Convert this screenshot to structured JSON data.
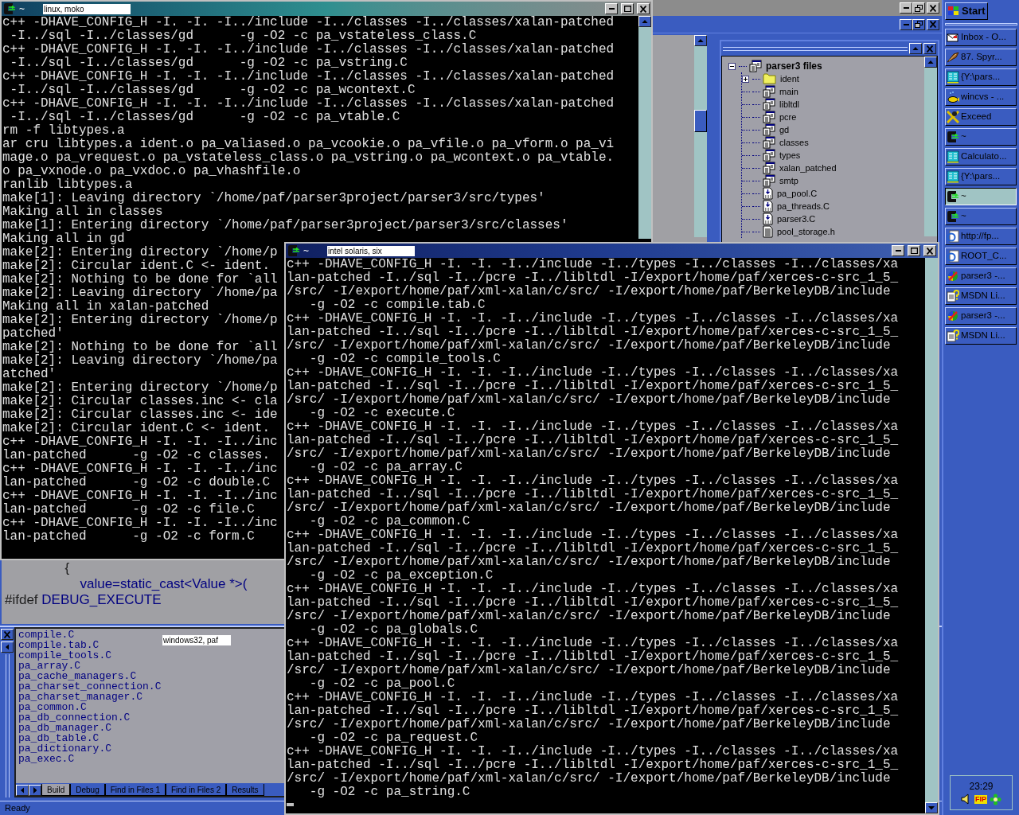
{
  "ide": {
    "code_lines": [
      [
        {
          "text": "                {",
          "kind": "plain"
        }
      ],
      [
        {
          "text": "                    value=static_cast<Value *>(",
          "kind": "identifier"
        }
      ],
      [
        {
          "text": "#ifdef ",
          "kind": "plain"
        },
        {
          "text": "DEBUG_EXECUTE",
          "kind": "identifier"
        }
      ]
    ],
    "tree": {
      "label": "parser3 files",
      "kind": "workspace",
      "expanded": true,
      "children": [
        {
          "label": "ident",
          "kind": "folder",
          "expanded": false
        },
        {
          "label": "main",
          "kind": "project"
        },
        {
          "label": "libltdl",
          "kind": "project"
        },
        {
          "label": "pcre",
          "kind": "project"
        },
        {
          "label": "gd",
          "kind": "project"
        },
        {
          "label": "classes",
          "kind": "project"
        },
        {
          "label": "types",
          "kind": "project"
        },
        {
          "label": "xalan_patched",
          "kind": "project"
        },
        {
          "label": "smtp",
          "kind": "project"
        },
        {
          "label": "pa_pool.C",
          "kind": "source"
        },
        {
          "label": "pa_threads.C",
          "kind": "source"
        },
        {
          "label": "parser3.C",
          "kind": "source"
        },
        {
          "label": "pool_storage.h",
          "kind": "header"
        }
      ]
    },
    "output_files": [
      "compile.C",
      "compile.tab.C",
      "compile_tools.C",
      "pa_array.C",
      "pa_cache_managers.C",
      "pa_charset_connection.C",
      "pa_charset_manager.C",
      "pa_common.C",
      "pa_db_connection.C",
      "pa_db_manager.C",
      "pa_db_table.C",
      "pa_dictionary.C",
      "pa_exec.C"
    ],
    "output_tabs": [
      {
        "label": "Build",
        "selected": true
      },
      {
        "label": "Debug",
        "selected": false
      },
      {
        "label": "Find in Files 1",
        "selected": false
      },
      {
        "label": "Find in Files 2",
        "selected": false
      },
      {
        "label": "Results",
        "selected": false
      }
    ],
    "host_label": "windows32, paf",
    "status": "Ready"
  },
  "terminals": [
    {
      "title": "~",
      "host": "linux, moko",
      "lines": [
        "c++ -DHAVE_CONFIG_H -I. -I. -I../include -I../classes -I../classes/xalan-patched",
        " -I../sql -I../classes/gd      -g -O2 -c pa_vstateless_class.C",
        "c++ -DHAVE_CONFIG_H -I. -I. -I../include -I../classes -I../classes/xalan-patched",
        " -I../sql -I../classes/gd      -g -O2 -c pa_vstring.C",
        "c++ -DHAVE_CONFIG_H -I. -I. -I../include -I../classes -I../classes/xalan-patched",
        " -I../sql -I../classes/gd      -g -O2 -c pa_wcontext.C",
        "c++ -DHAVE_CONFIG_H -I. -I. -I../include -I../classes -I../classes/xalan-patched",
        " -I../sql -I../classes/gd      -g -O2 -c pa_vtable.C",
        "rm -f libtypes.a",
        "ar cru libtypes.a ident.o pa_valiased.o pa_vcookie.o pa_vfile.o pa_vform.o pa_vi",
        "mage.o pa_vrequest.o pa_vstateless_class.o pa_vstring.o pa_wcontext.o pa_vtable.",
        "o pa_vxnode.o pa_vxdoc.o pa_vhashfile.o",
        "ranlib libtypes.a",
        "make[1]: Leaving directory `/home/paf/parser3project/parser3/src/types'",
        "Making all in classes",
        "make[1]: Entering directory `/home/paf/parser3project/parser3/src/classes'",
        "Making all in gd",
        "make[2]: Entering directory `/home/p",
        "make[2]: Circular ident.C <- ident.",
        "make[2]: Nothing to be done for `all",
        "make[2]: Leaving directory `/home/pa",
        "Making all in xalan-patched",
        "make[2]: Entering directory `/home/p",
        "patched'",
        "make[2]: Nothing to be done for `all",
        "make[2]: Leaving directory `/home/pa",
        "atched'",
        "make[2]: Entering directory `/home/p",
        "make[2]: Circular classes.inc <- cla",
        "make[2]: Circular classes.inc <- ide",
        "make[2]: Circular ident.C <- ident.",
        "c++ -DHAVE_CONFIG_H -I. -I. -I../inc",
        "lan-patched      -g -O2 -c classes.",
        "c++ -DHAVE_CONFIG_H -I. -I. -I../inc",
        "lan-patched      -g -O2 -c double.C",
        "c++ -DHAVE_CONFIG_H -I. -I. -I../inc",
        "lan-patched      -g -O2 -c file.C",
        "c++ -DHAVE_CONFIG_H -I. -I. -I../inc",
        "lan-patched      -g -O2 -c form.C"
      ]
    },
    {
      "title": "~",
      "host": "intel solaris, six",
      "lines": [
        "c++ -DHAVE_CONFIG_H -I. -I. -I../include -I../types -I../classes -I../classes/xa",
        "lan-patched -I../sql -I../pcre -I../libltdl -I/export/home/paf/xerces-c-src_1_5_",
        "/src/ -I/export/home/paf/xml-xalan/c/src/ -I/export/home/paf/BerkeleyDB/include",
        "   -g -O2 -c compile.tab.C",
        "c++ -DHAVE_CONFIG_H -I. -I. -I../include -I../types -I../classes -I../classes/xa",
        "lan-patched -I../sql -I../pcre -I../libltdl -I/export/home/paf/xerces-c-src_1_5_",
        "/src/ -I/export/home/paf/xml-xalan/c/src/ -I/export/home/paf/BerkeleyDB/include",
        "   -g -O2 -c compile_tools.C",
        "c++ -DHAVE_CONFIG_H -I. -I. -I../include -I../types -I../classes -I../classes/xa",
        "lan-patched -I../sql -I../pcre -I../libltdl -I/export/home/paf/xerces-c-src_1_5_",
        "/src/ -I/export/home/paf/xml-xalan/c/src/ -I/export/home/paf/BerkeleyDB/include",
        "   -g -O2 -c execute.C",
        "c++ -DHAVE_CONFIG_H -I. -I. -I../include -I../types -I../classes -I../classes/xa",
        "lan-patched -I../sql -I../pcre -I../libltdl -I/export/home/paf/xerces-c-src_1_5_",
        "/src/ -I/export/home/paf/xml-xalan/c/src/ -I/export/home/paf/BerkeleyDB/include",
        "   -g -O2 -c pa_array.C",
        "c++ -DHAVE_CONFIG_H -I. -I. -I../include -I../types -I../classes -I../classes/xa",
        "lan-patched -I../sql -I../pcre -I../libltdl -I/export/home/paf/xerces-c-src_1_5_",
        "/src/ -I/export/home/paf/xml-xalan/c/src/ -I/export/home/paf/BerkeleyDB/include",
        "   -g -O2 -c pa_common.C",
        "c++ -DHAVE_CONFIG_H -I. -I. -I../include -I../types -I../classes -I../classes/xa",
        "lan-patched -I../sql -I../pcre -I../libltdl -I/export/home/paf/xerces-c-src_1_5_",
        "/src/ -I/export/home/paf/xml-xalan/c/src/ -I/export/home/paf/BerkeleyDB/include",
        "   -g -O2 -c pa_exception.C",
        "c++ -DHAVE_CONFIG_H -I. -I. -I../include -I../types -I../classes -I../classes/xa",
        "lan-patched -I../sql -I../pcre -I../libltdl -I/export/home/paf/xerces-c-src_1_5_",
        "/src/ -I/export/home/paf/xml-xalan/c/src/ -I/export/home/paf/BerkeleyDB/include",
        "   -g -O2 -c pa_globals.C",
        "c++ -DHAVE_CONFIG_H -I. -I. -I../include -I../types -I../classes -I../classes/xa",
        "lan-patched -I../sql -I../pcre -I../libltdl -I/export/home/paf/xerces-c-src_1_5_",
        "/src/ -I/export/home/paf/xml-xalan/c/src/ -I/export/home/paf/BerkeleyDB/include",
        "   -g -O2 -c pa_pool.C",
        "c++ -DHAVE_CONFIG_H -I. -I. -I../include -I../types -I../classes -I../classes/xa",
        "lan-patched -I../sql -I../pcre -I../libltdl -I/export/home/paf/xerces-c-src_1_5_",
        "/src/ -I/export/home/paf/xml-xalan/c/src/ -I/export/home/paf/BerkeleyDB/include",
        "   -g -O2 -c pa_request.C",
        "c++ -DHAVE_CONFIG_H -I. -I. -I../include -I../types -I../classes -I../classes/xa",
        "lan-patched -I../sql -I../pcre -I../libltdl -I/export/home/paf/xerces-c-src_1_5_",
        "/src/ -I/export/home/paf/xml-xalan/c/src/ -I/export/home/paf/BerkeleyDB/include",
        "   -g -O2 -c pa_string.C"
      ]
    }
  ],
  "taskbar": {
    "start": "Start",
    "buttons": [
      {
        "label": "Inbox - O...",
        "kind": "mail",
        "selected": false
      },
      {
        "label": "87. Spyr...",
        "kind": "tool",
        "selected": false
      },
      {
        "label": "{Y:\\pars...",
        "kind": "columns",
        "selected": false
      },
      {
        "label": "wincvs - ...",
        "kind": "fish",
        "selected": false
      },
      {
        "label": "Exceed",
        "kind": "exceed",
        "selected": false
      },
      {
        "label": "~",
        "kind": "terminal",
        "selected": false
      },
      {
        "label": "Calculato...",
        "kind": "columns",
        "selected": false
      },
      {
        "label": "{Y:\\pars...",
        "kind": "columns",
        "selected": false
      },
      {
        "label": "~",
        "kind": "terminal",
        "selected": true
      },
      {
        "label": "~",
        "kind": "terminal",
        "selected": false
      },
      {
        "label": "http://fp...",
        "kind": "browser",
        "selected": false
      },
      {
        "label": "ROOT_C...",
        "kind": "browser",
        "selected": false
      },
      {
        "label": "parser3 -...",
        "kind": "studio",
        "selected": false
      },
      {
        "label": "MSDN Li...",
        "kind": "help",
        "selected": false
      },
      {
        "label": "parser3 -...",
        "kind": "studio",
        "selected": false
      },
      {
        "label": "MSDN Li...",
        "kind": "help",
        "selected": false
      }
    ],
    "tray_badge": "FIP",
    "clock": "23:29"
  }
}
